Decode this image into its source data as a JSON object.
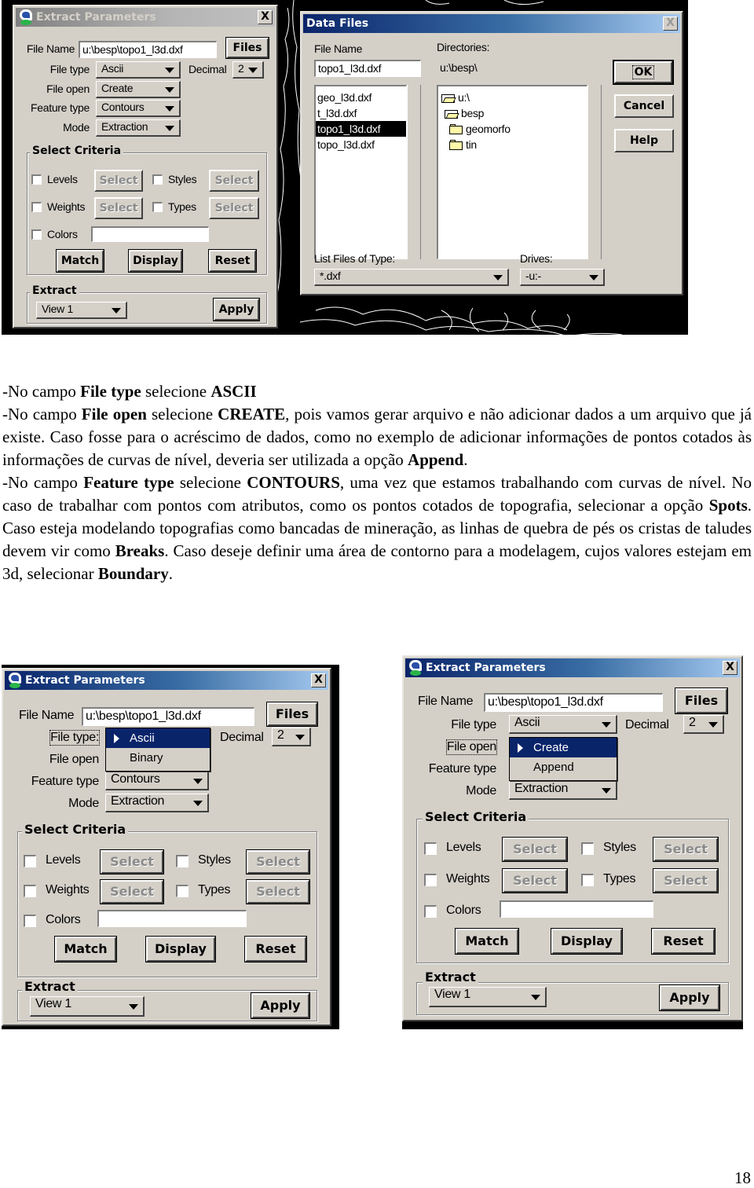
{
  "top_screenshot": {
    "extract_dialog": {
      "title": "Extract Parameters",
      "state": "inactive",
      "close_label": "X",
      "file_name_label": "File Name",
      "file_name_value": "u:\\besp\\topo1_l3d.dxf",
      "files_button": "Files",
      "file_type_label": "File type",
      "file_type_value": "Ascii",
      "decimal_label": "Decimal",
      "decimal_value": "2",
      "file_open_label": "File open",
      "file_open_value": "Create",
      "feature_type_label": "Feature type",
      "feature_type_value": "Contours",
      "mode_label": "Mode",
      "mode_value": "Extraction",
      "select_criteria_title": "Select Criteria",
      "levels_label": "Levels",
      "styles_label": "Styles",
      "weights_label": "Weights",
      "types_label": "Types",
      "colors_label": "Colors",
      "colors_value": "",
      "select_label": "Select",
      "match_button": "Match",
      "display_button": "Display",
      "reset_button": "Reset",
      "extract_title": "Extract",
      "extract_value": "View 1",
      "apply_button": "Apply"
    },
    "data_files_dialog": {
      "title": "Data Files",
      "close_label": "X",
      "file_name_label": "File Name",
      "file_name_value": "topo1_l3d.dxf",
      "directories_label": "Directories:",
      "current_dir": "u:\\besp\\",
      "files": [
        {
          "name": "geo_l3d.dxf",
          "selected": false
        },
        {
          "name": "t_l3d.dxf",
          "selected": false
        },
        {
          "name": "topo1_l3d.dxf",
          "selected": true
        },
        {
          "name": "topo_l3d.dxf",
          "selected": false
        }
      ],
      "directories": [
        {
          "name": "u:\\",
          "icon": "open-folder-icon"
        },
        {
          "name": "besp",
          "icon": "open-folder-icon"
        },
        {
          "name": "geomorfo",
          "icon": "folder-icon"
        },
        {
          "name": "tin",
          "icon": "folder-icon"
        }
      ],
      "ok_button": "OK",
      "cancel_button": "Cancel",
      "help_button": "Help",
      "list_type_label": "List Files of Type:",
      "list_type_value": "*.dxf",
      "drives_label": "Drives:",
      "drives_value": "-u:-"
    }
  },
  "instructions": {
    "p1": {
      "t1": "-No campo ",
      "b1": "File type",
      "t2": " selecione ",
      "b2": "ASCII"
    },
    "p2": {
      "t1": "-No campo ",
      "b1": "File open",
      "t2": " selecione ",
      "b2": "CREATE",
      "t3": ", pois vamos gerar arquivo e não adicionar dados a um arquivo que já existe. Caso fosse para o acréscimo de dados, como no exemplo de adicionar informações de pontos cotados às informações de curvas de nível, deveria ser utilizada a opção ",
      "b3": "Append",
      "t4": "."
    },
    "p3": {
      "t1": "-No campo ",
      "b1": "Feature type",
      "t2": " selecione ",
      "b2": "CONTOURS",
      "t3": ", uma vez que estamos trabalhando com curvas de nível. No caso de trabalhar com pontos com atributos, como os pontos cotados de topografia, selecionar a opção ",
      "b3": "Spots",
      "t4": ". Caso esteja modelando topografias como bancadas de mineração, as linhas de quebra de pés os cristas de taludes devem vir como ",
      "b4": "Breaks",
      "t5": ". Caso deseje definir uma área de contorno para a modelagem, cujos valores estejam em 3d, selecionar ",
      "b5": "Boundary",
      "t6": "."
    }
  },
  "bottom_left_dialog": {
    "title": "Extract Parameters",
    "close_label": "X",
    "file_name_label": "File Name",
    "file_name_value": "u:\\besp\\topo1_l3d.dxf",
    "files_button": "Files",
    "file_type_label": "File type:",
    "decimal_label": "Decimal",
    "decimal_value": "2",
    "file_open_label": "File open",
    "feature_type_label": "Feature type",
    "feature_type_value": "Contours",
    "mode_label": "Mode",
    "mode_value": "Extraction",
    "dropdown_options": [
      {
        "label": "Ascii",
        "selected": true
      },
      {
        "label": "Binary",
        "selected": false
      }
    ],
    "select_criteria_title": "Select Criteria",
    "levels_label": "Levels",
    "styles_label": "Styles",
    "weights_label": "Weights",
    "types_label": "Types",
    "colors_label": "Colors",
    "colors_value": "",
    "select_label": "Select",
    "match_button": "Match",
    "display_button": "Display",
    "reset_button": "Reset",
    "extract_title": "Extract",
    "extract_value": "View 1",
    "apply_button": "Apply"
  },
  "bottom_right_dialog": {
    "title": "Extract Parameters",
    "close_label": "X",
    "file_name_label": "File Name",
    "file_name_value": "u:\\besp\\topo1_l3d.dxf",
    "files_button": "Files",
    "file_type_label": "File type",
    "file_type_value": "Ascii",
    "decimal_label": "Decimal",
    "decimal_value": "2",
    "file_open_label": "File open",
    "feature_type_label": "Feature type",
    "mode_label": "Mode",
    "mode_value": "Extraction",
    "dropdown_options": [
      {
        "label": "Create",
        "selected": true
      },
      {
        "label": "Append",
        "selected": false
      }
    ],
    "select_criteria_title": "Select Criteria",
    "levels_label": "Levels",
    "styles_label": "Styles",
    "weights_label": "Weights",
    "types_label": "Types",
    "colors_label": "Colors",
    "colors_value": "",
    "select_label": "Select",
    "match_button": "Match",
    "display_button": "Display",
    "reset_button": "Reset",
    "extract_title": "Extract",
    "extract_value": "View 1",
    "apply_button": "Apply"
  },
  "page_number": "18"
}
